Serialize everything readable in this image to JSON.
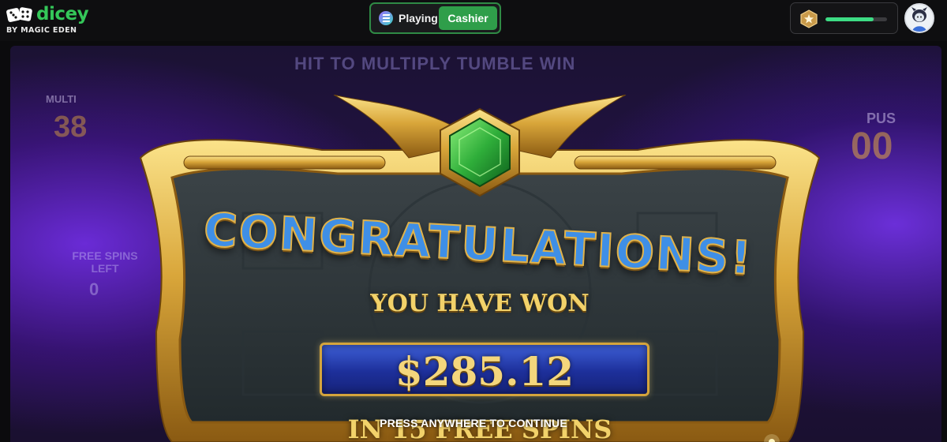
{
  "brand": {
    "name": "dicey",
    "tagline": "BY MAGIC EDEN",
    "accent_color": "#34c759"
  },
  "header": {
    "mode_toggle": {
      "playing_label": "Playing",
      "cashier_label": "Cashier",
      "active": "Cashier",
      "currency_icon": "solana-icon"
    },
    "level": {
      "badge_icon": "star-badge-icon",
      "progress": 0.78
    },
    "avatar_icon": "user-avatar"
  },
  "game": {
    "background": {
      "title": "HIT TO MULTIPLY TUMBLE WIN",
      "multiplier_label": "MULTI",
      "multiplier_value": "38",
      "spins_label": "FREE SPINS LEFT",
      "spins_value": "0",
      "right_label": "PUS",
      "right_value": "00"
    },
    "win_popup": {
      "headline": "CONGRATULATIONS!",
      "subheadline": "YOU HAVE WON",
      "amount": "$285.12",
      "spins_text": "IN 15 FREE SPINS",
      "continue_prompt": "PRESS ANYWHERE TO CONTINUE",
      "gem_icon": "emerald-gem-icon"
    }
  }
}
